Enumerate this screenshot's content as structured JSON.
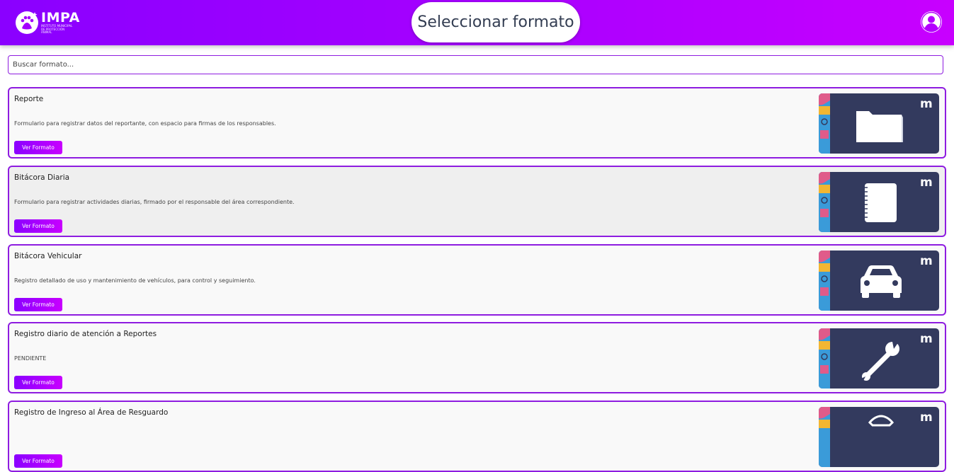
{
  "header": {
    "logo_title": "IMPA",
    "logo_subtitle": "INSTITUTO MUNICIPAL DE PROTECCIÓN ANIMAL",
    "page_title": "Seleccionar formato"
  },
  "search": {
    "placeholder": "Buscar formato..."
  },
  "cards": [
    {
      "title": "Reporte",
      "description": "Formulario para registrar datos del reportante, con espacio para firmas de los responsables.",
      "button_label": "Ver Formato",
      "icon": "folder-icon"
    },
    {
      "title": "Bitácora Diaria",
      "description": "Formulario para registrar actividades diarias, firmado por el responsable del área correspondiente.",
      "button_label": "Ver Formato",
      "icon": "notebook-icon"
    },
    {
      "title": "Bitácora Vehicular",
      "description": "Registro detallado de uso y mantenimiento de vehículos, para control y seguimiento.",
      "button_label": "Ver Formato",
      "icon": "car-icon"
    },
    {
      "title": "Registro diario de atención a Reportes",
      "description": "PENDIENTE",
      "button_label": "Ver Formato",
      "icon": "wrench-icon"
    },
    {
      "title": "Registro de Ingreso al Área de Resguardo",
      "description": "",
      "button_label": "Ver Formato",
      "icon": "badge-icon"
    }
  ],
  "thumbnail_brand": "m",
  "colors": {
    "accent": "#8e1ce0",
    "header_start": "#8a00ff",
    "header_end": "#c800ff",
    "thumb_bg": "#333a5e"
  }
}
